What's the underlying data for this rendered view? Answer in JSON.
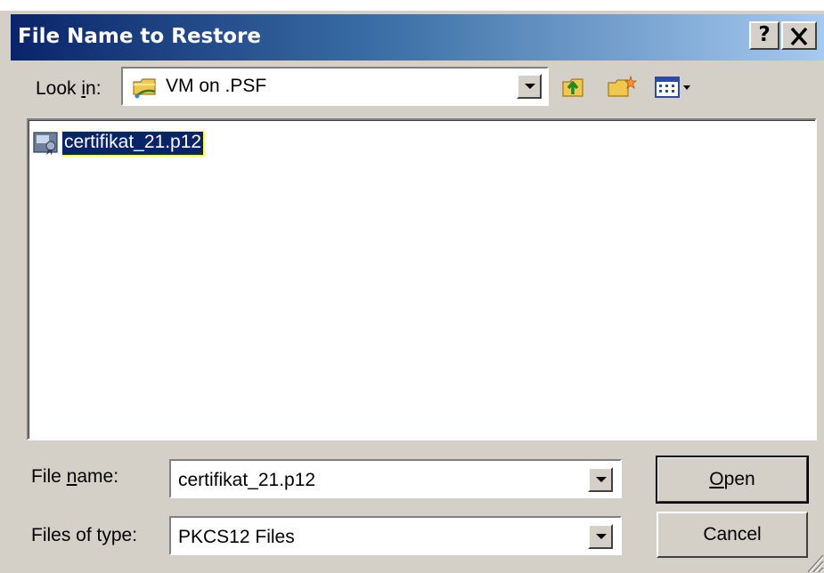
{
  "dialog": {
    "title": "File Name to Restore",
    "help_label": "?",
    "close_label": "✕"
  },
  "look_in": {
    "label_prefix": "Look ",
    "label_underlined": "i",
    "label_suffix": "n:",
    "value": "VM on .PSF",
    "icon": "network-folder-icon"
  },
  "toolbar": {
    "up_icon": "up-one-level-icon",
    "new_folder_icon": "new-folder-icon",
    "views_icon": "views-menu-icon"
  },
  "files": [
    {
      "name": "certifikat_21.p12",
      "icon": "certificate-file-icon",
      "selected": true
    }
  ],
  "file_name": {
    "label_prefix": "File ",
    "label_underlined": "n",
    "label_suffix": "ame:",
    "value": "certifikat_21.p12"
  },
  "file_type": {
    "label": "Files of type:",
    "value": "PKCS12 Files"
  },
  "buttons": {
    "open_underlined": "O",
    "open_rest": "pen",
    "cancel": "Cancel"
  },
  "colors": {
    "title_gradient_start": "#0a246a",
    "title_gradient_end": "#a6caf0",
    "dialog_background": "#d4d0c8",
    "selection": "#0a246a"
  }
}
